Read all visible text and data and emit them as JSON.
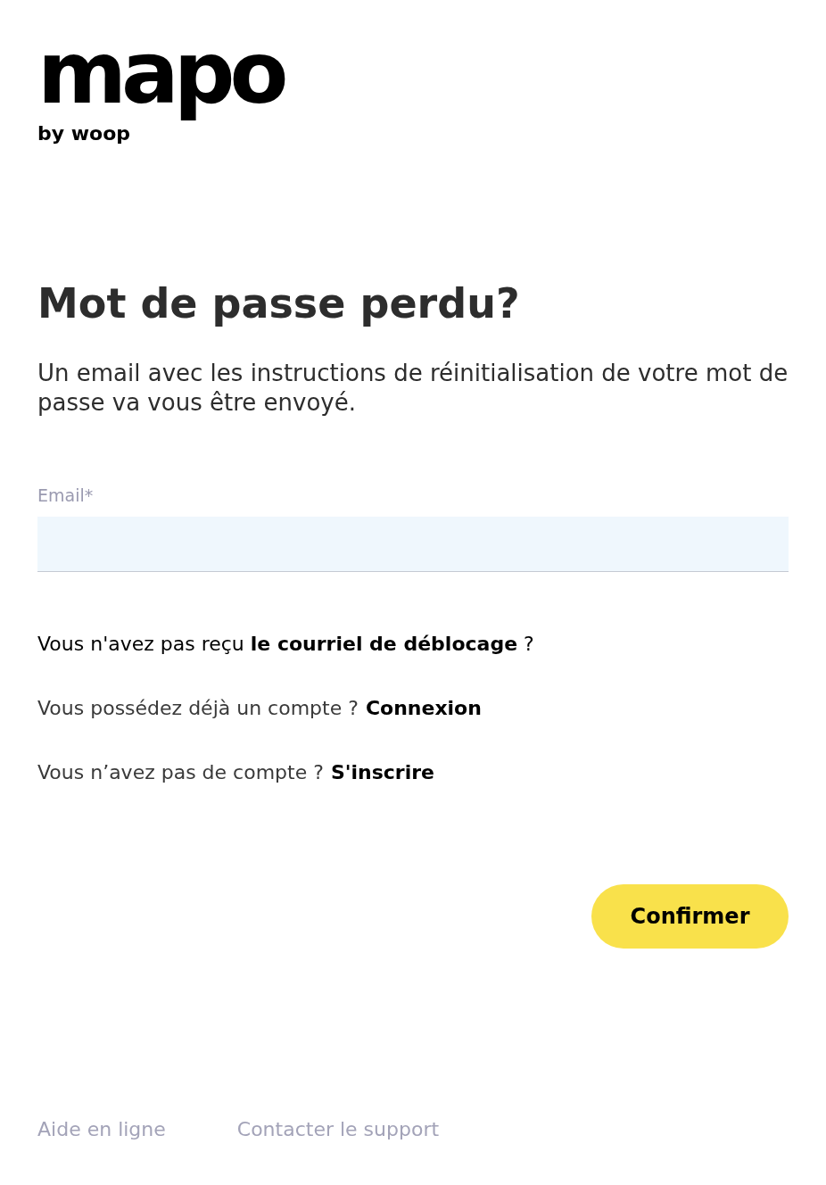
{
  "logo": {
    "name": "mapo",
    "byline": "by woop"
  },
  "title": "Mot de passe perdu?",
  "description": "Un email avec les instructions de réinitialisation de votre mot de passe va vous être envoyé.",
  "email_field": {
    "label": "Email*"
  },
  "unlock_link": "Vous n'avez pas reçu **le courriel de déblocage** ?",
  "account_links": [
    {
      "prompt": "Vous possédez déjà un compte ?",
      "link": "Connexion"
    },
    {
      "prompt": "Vous n’avez pas de compte ?",
      "link": "S'inscrire"
    }
  ],
  "confirm_button": "Confirmer",
  "footer_links": [
    "Aide en ligne",
    "Contacter le support"
  ]
}
